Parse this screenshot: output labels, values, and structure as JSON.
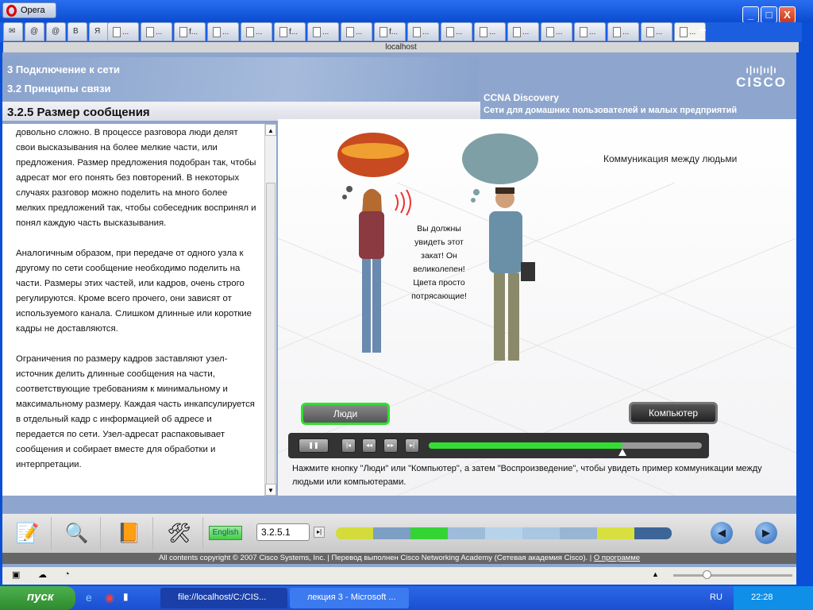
{
  "browser": {
    "menu_label": "Opera",
    "address": "localhost",
    "tabs": [
      "...",
      "...",
      "f...",
      "...",
      "...",
      "f...",
      "...",
      "...",
      "f...",
      "...",
      "...",
      "...",
      "...",
      "...",
      "...",
      "...",
      "...",
      "..."
    ],
    "controls": {
      "minimize": "_",
      "maximize": "□",
      "close": "X"
    }
  },
  "header": {
    "chapter": "3 Подключение к сети",
    "section": "3.2 Принципы связи",
    "page_title": "3.2.5 Размер сообщения",
    "course": "CCNA Discovery",
    "course_subtitle": "Сети для домашних пользователей и малых предприятий",
    "logo_text": "CISCO"
  },
  "left_text": [
    "довольно сложно. В процессе разговора люди делят свои высказывания на более мелкие части, или предложения. Размер предложения подобран так, чтобы адресат мог его понять без повторений. В некоторых случаях разговор можно поделить на много более мелких предложений так, чтобы собеседник воспринял и понял каждую часть высказывания.",
    "Аналогичным образом, при передаче от одного узла к другому по сети сообщение необходимо поделить на части. Размеры этих частей, или кадров, очень строго регулируются. Кроме всего прочего, они зависят от используемого канала. Слишком длинные или короткие кадры не доставляются.",
    "Ограничения по размеру кадров заставляют узел-источник делить длинные сообщения на части, соответствующие требованиям к минимальному и максимальному размеру. Каждая часть инкапсулируется в отдельный кадр с информацией об адресе и передается по сети. Узел-адресат распаковывает сообщения и собирает вместе для обработки и интерпретации."
  ],
  "animation": {
    "title": "Коммуникация между людьми",
    "speech": "Вы должны увидеть этот закат! Он великолепен! Цвета просто потрясающие!",
    "people_button": "Люди",
    "computer_button": "Компьютер",
    "progress": 0.71,
    "instruction": "Нажмите кнопку \"Люди\" или \"Компьютер\", а затем \"Воспроизведение\", чтобы увидеть пример коммуникации между людьми или компьютерами."
  },
  "toolbar": {
    "language": "English",
    "page_number": "3.2.5.1",
    "progress_segments": [
      "#d4dc3c",
      "#7d9fc4",
      "#33d433",
      "#9dbcd9",
      "#b7d3ea",
      "#a9c6e2",
      "#98b6d4",
      "#d8e040",
      "#3d6598"
    ]
  },
  "footer": {
    "copyright": "All contents copyright © 2007 Cisco Systems, Inc. | Перевод выполнен Cisco Networking Academy (Сетевая академия Cisco). | ",
    "about_link": "О программе"
  },
  "taskbar": {
    "start": "пуск",
    "tasks": [
      "file://localhost/C:/CIS...",
      "лекция 3 - Microsoft ..."
    ],
    "language": "RU",
    "clock": "22:28"
  }
}
